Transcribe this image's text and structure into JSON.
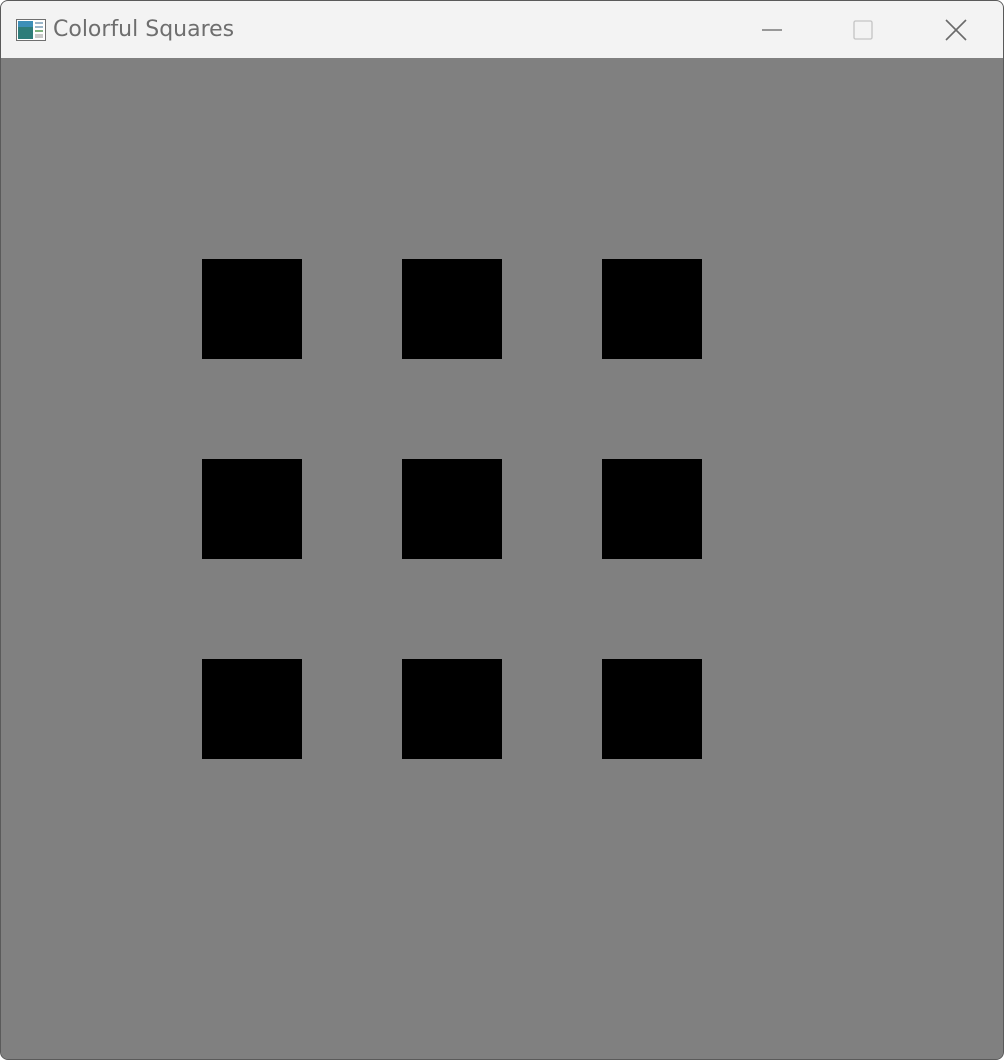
{
  "window": {
    "title": "Colorful Squares",
    "app_icon": "app-window-icon",
    "controls": [
      "minimize-icon",
      "maximize-icon",
      "close-icon"
    ]
  },
  "canvas": {
    "background_color": "#808080",
    "grid_rows": 3,
    "grid_cols": 3,
    "squares": [
      {
        "row": 1,
        "col": 1,
        "color": "#000000"
      },
      {
        "row": 1,
        "col": 2,
        "color": "#000000"
      },
      {
        "row": 1,
        "col": 3,
        "color": "#000000"
      },
      {
        "row": 2,
        "col": 1,
        "color": "#000000"
      },
      {
        "row": 2,
        "col": 2,
        "color": "#000000"
      },
      {
        "row": 2,
        "col": 3,
        "color": "#000000"
      },
      {
        "row": 3,
        "col": 1,
        "color": "#000000"
      },
      {
        "row": 3,
        "col": 2,
        "color": "#000000"
      },
      {
        "row": 3,
        "col": 3,
        "color": "#000000"
      }
    ]
  }
}
